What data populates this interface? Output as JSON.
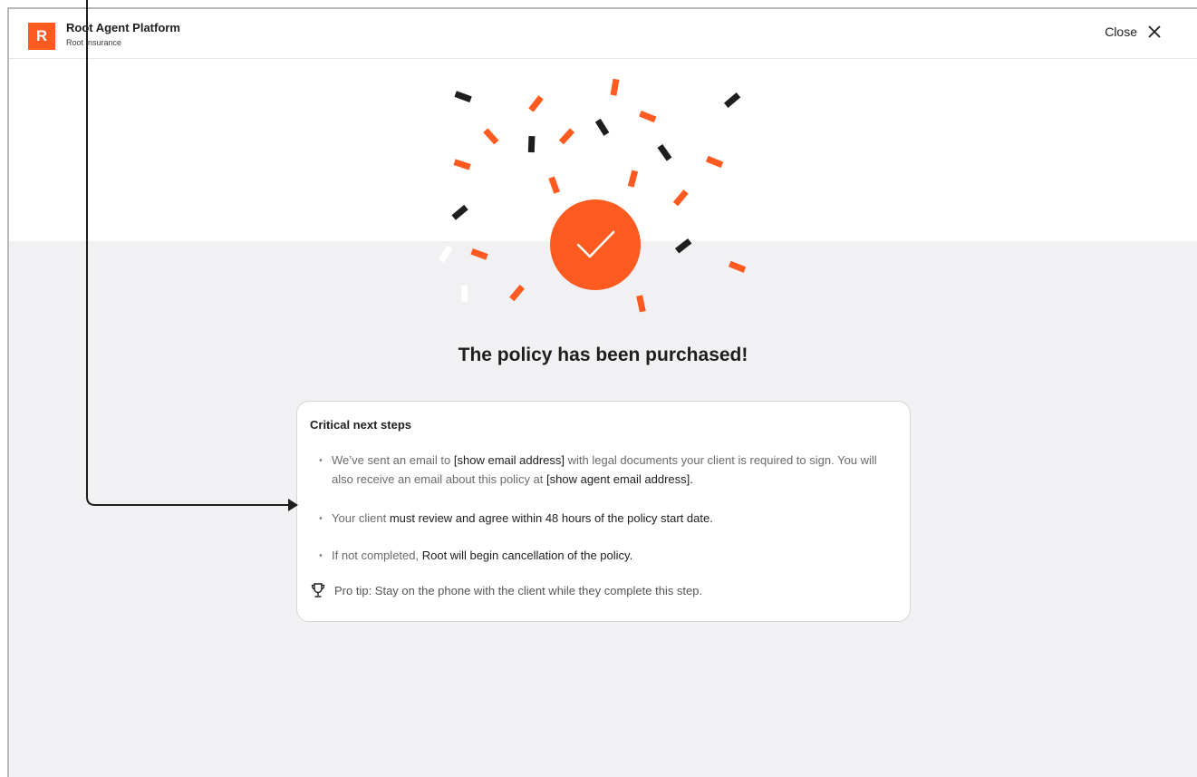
{
  "app": {
    "logo_letter": "R",
    "title": "Root Agent Platform",
    "subtitle": "Root Insurance",
    "close_label": "Close"
  },
  "colors": {
    "accent": "#ff5a1f",
    "dark": "#1e1e1e",
    "band": "#f1f1f3"
  },
  "success": {
    "icon": "checkmark-icon",
    "headline": "The policy has been purchased!"
  },
  "card": {
    "title": "Critical next steps",
    "step1": {
      "a": "We’ve sent an email to ",
      "b": "[show email address]",
      "c": " with legal documents your client is required to sign. You will also receive an email about this policy at ",
      "d": "[show agent email address]",
      "e": "."
    },
    "step2": {
      "a": "Your client ",
      "b": "must review and agree within 48 hours of the policy start date."
    },
    "step3": {
      "a": "If not completed, ",
      "b": "Root will begin cancellation of the policy."
    },
    "bullet": "•",
    "tip_icon": "trophy-icon",
    "tip": "Pro tip: Stay on the phone with the client while they complete this step."
  }
}
